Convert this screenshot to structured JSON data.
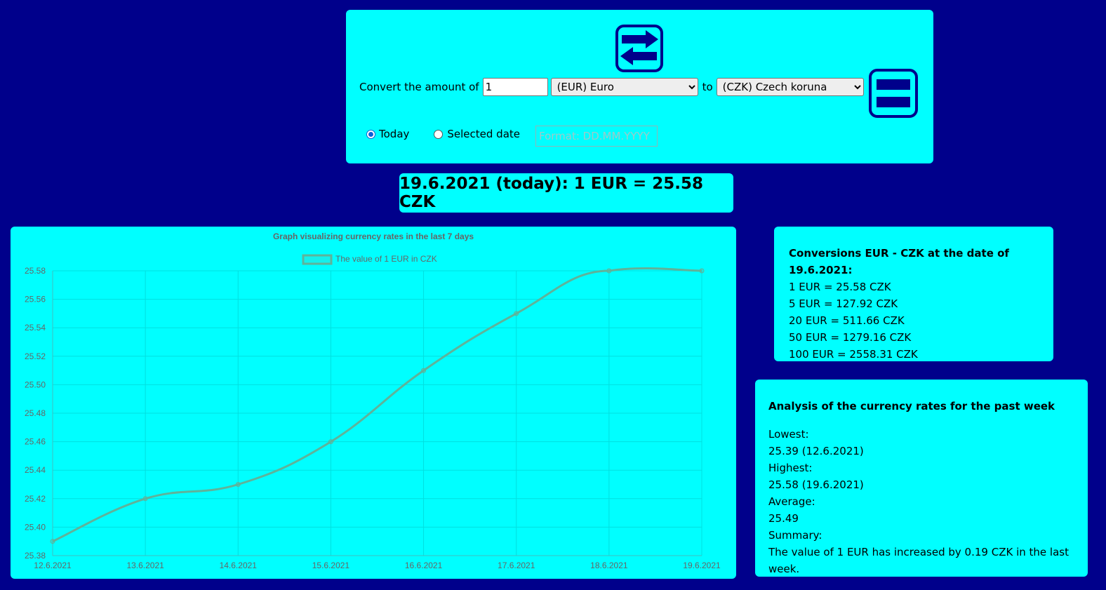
{
  "converter": {
    "convert_label": "Convert the amount of",
    "amount_value": "1",
    "from_currency": "(EUR) Euro",
    "to_label": "to",
    "to_currency": "(CZK) Czech koruna",
    "radio_today": "Today",
    "radio_selected": "Selected date",
    "radio_checked": "today",
    "date_placeholder": "Format: DD.MM.YYYY"
  },
  "result": {
    "text": "19.6.2021 (today): 1 EUR = 25.58 CZK"
  },
  "conversions": {
    "title": "Conversions EUR - CZK at the date of 19.6.2021:",
    "lines": [
      "1 EUR = 25.58 CZK",
      "5 EUR = 127.92 CZK",
      "20 EUR = 511.66 CZK",
      "50 EUR = 1279.16 CZK",
      "100 EUR = 2558.31 CZK"
    ]
  },
  "analysis": {
    "title": "Analysis of the currency rates for the past week",
    "lowest_label": "Lowest:",
    "lowest_value": "25.39 (12.6.2021)",
    "highest_label": "Highest:",
    "highest_value": "25.58 (19.6.2021)",
    "average_label": "Average:",
    "average_value": "25.49",
    "summary_label": "Summary:",
    "summary_value": "The value of 1 EUR has increased by 0.19 CZK in the last week."
  },
  "colors": {
    "background": "#00008b",
    "panel": "#00ffff",
    "icon": "#00008b",
    "line": "#5fb39a",
    "chart_text": "#666666",
    "grid": "#00e0e0"
  },
  "icons": {
    "swap": "swap-arrows-icon",
    "convert": "equals-icon"
  },
  "chart_data": {
    "type": "line",
    "title": "Graph visualizing currency rates in the last 7 days",
    "xlabel": "",
    "ylabel": "",
    "categories": [
      "12.6.2021",
      "13.6.2021",
      "14.6.2021",
      "15.6.2021",
      "16.6.2021",
      "17.6.2021",
      "18.6.2021",
      "19.6.2021"
    ],
    "series": [
      {
        "name": "The value of 1 EUR in CZK",
        "values": [
          25.39,
          25.42,
          25.43,
          25.46,
          25.51,
          25.55,
          25.58,
          25.58
        ]
      }
    ],
    "ylim": [
      25.38,
      25.58
    ],
    "yticks": [
      "25.58",
      "25.56",
      "25.54",
      "25.52",
      "25.50",
      "25.48",
      "25.46",
      "25.44",
      "25.42",
      "25.40",
      "25.38"
    ],
    "grid": true,
    "legend": "top-center"
  }
}
